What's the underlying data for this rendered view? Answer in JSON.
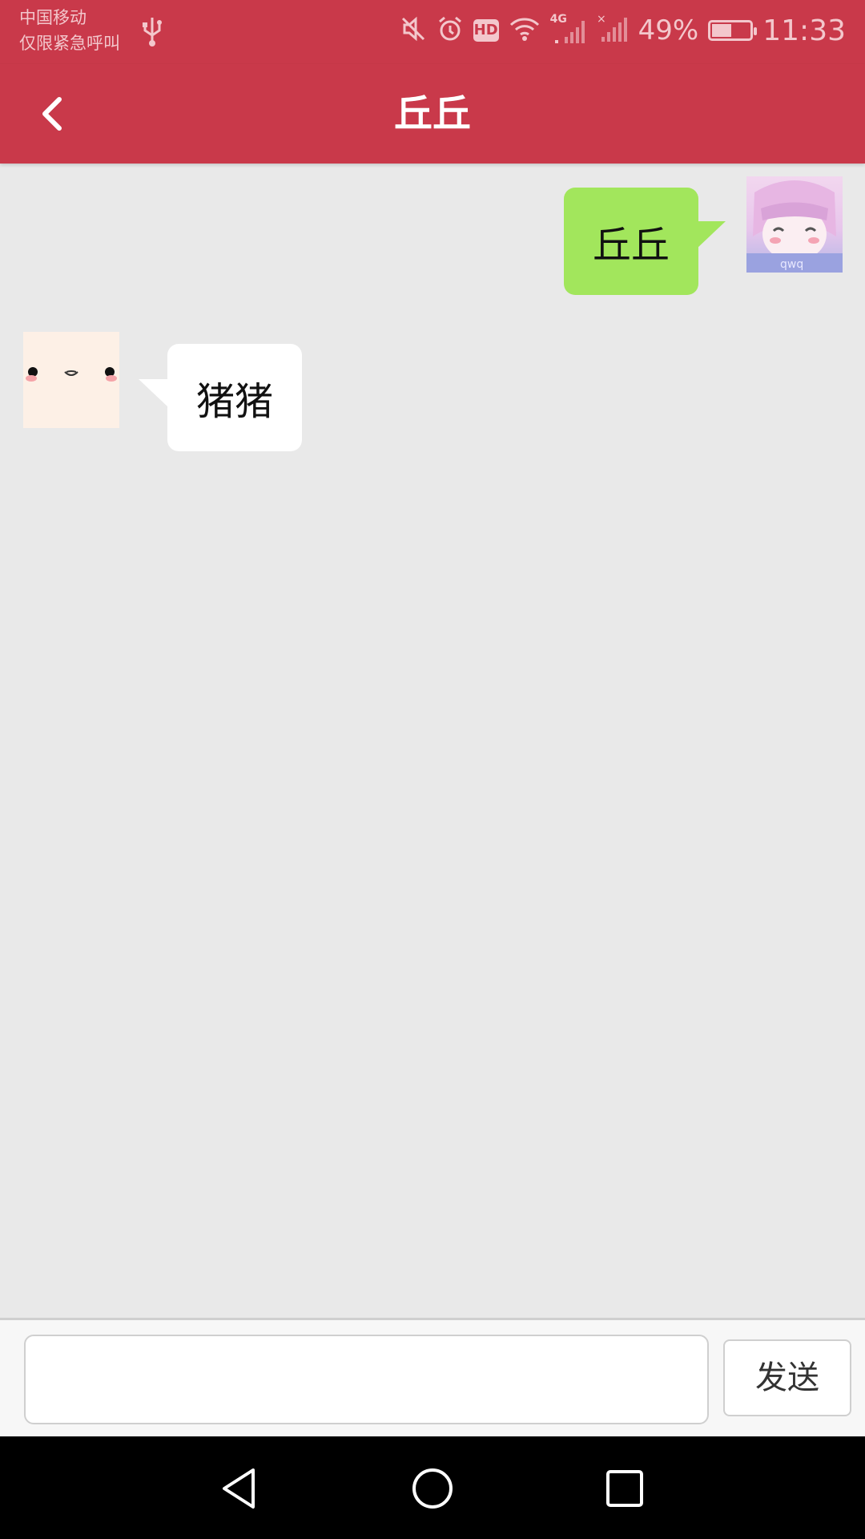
{
  "status_bar": {
    "carrier_line1": "中国移动",
    "carrier_line2": "仅限紧急呼叫",
    "network": "4G",
    "battery": "49%",
    "time": "11:33",
    "icons": [
      "usb-icon",
      "mute-icon",
      "alarm-icon",
      "hd-icon",
      "wifi-icon",
      "signal-icon",
      "signal-none-icon",
      "battery-charging-icon"
    ]
  },
  "header": {
    "title": "丘丘",
    "back_icon": "chevron-left-icon"
  },
  "messages": [
    {
      "side": "right",
      "text": "丘丘",
      "avatar": "anime-girl-avatar",
      "bubble_color": "#a2e65c"
    },
    {
      "side": "left",
      "text": "猪猪",
      "avatar": "cute-face-avatar",
      "bubble_color": "#ffffff"
    }
  ],
  "composer": {
    "input_value": "",
    "input_placeholder": "",
    "send_label": "发送"
  },
  "nav": {
    "icons": [
      "back-triangle-icon",
      "home-circle-icon",
      "recents-square-icon"
    ]
  },
  "colors": {
    "accent": "#c9394a",
    "background": "#e9e9e9"
  }
}
